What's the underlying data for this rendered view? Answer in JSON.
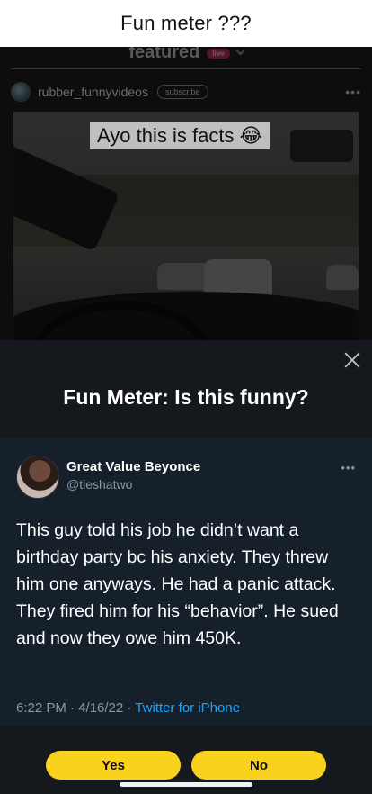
{
  "caption": "Fun meter ???",
  "background_app": {
    "featured_label": "featured",
    "live_badge": "live",
    "username": "rubber_funnyvideos",
    "subscribe_label": "subscribe",
    "more_glyph": "•••",
    "video_caption": "Ayo this is facts 😂"
  },
  "modal": {
    "title": "Fun Meter: Is this funny?",
    "close_icon": "close-icon",
    "tweet": {
      "display_name": "Great Value Beyonce",
      "handle": "@tieshatwo",
      "more_glyph": "•••",
      "text": "This guy told his job he didn’t want a birthday party bc his anxiety. They threw him one anyways. He had a panic attack. They fired him for his “behavior”. He sued and now they owe him 450K.",
      "timestamp": "6:22 PM · 4/16/22 · ",
      "source": "Twitter for iPhone"
    },
    "yes_label": "Yes",
    "no_label": "No"
  },
  "colors": {
    "accent_yellow": "#f9d21e",
    "tweet_bg": "#15202b",
    "twitter_blue": "#1da1f2",
    "modal_bg": "#15181c"
  }
}
